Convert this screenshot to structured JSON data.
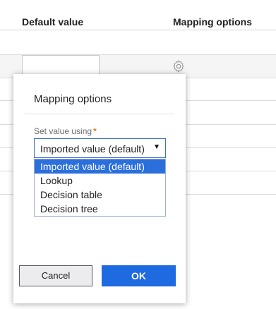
{
  "table": {
    "columns": {
      "default_value": "Default value",
      "mapping_options": "Mapping options"
    }
  },
  "modal": {
    "title": "Mapping options",
    "field_label": "Set value using",
    "required_marker": "*",
    "selected_value": "Imported value (default)",
    "options": [
      "Imported value (default)",
      "Lookup",
      "Decision table",
      "Decision tree"
    ],
    "cancel_label": "Cancel",
    "ok_label": "OK"
  },
  "colors": {
    "accent": "#1e6ae0",
    "selected_option": "#2b6fdc",
    "required": "#e87722"
  },
  "icons": {
    "row_settings": "gear-icon",
    "dropdown": "caret-down-icon"
  }
}
